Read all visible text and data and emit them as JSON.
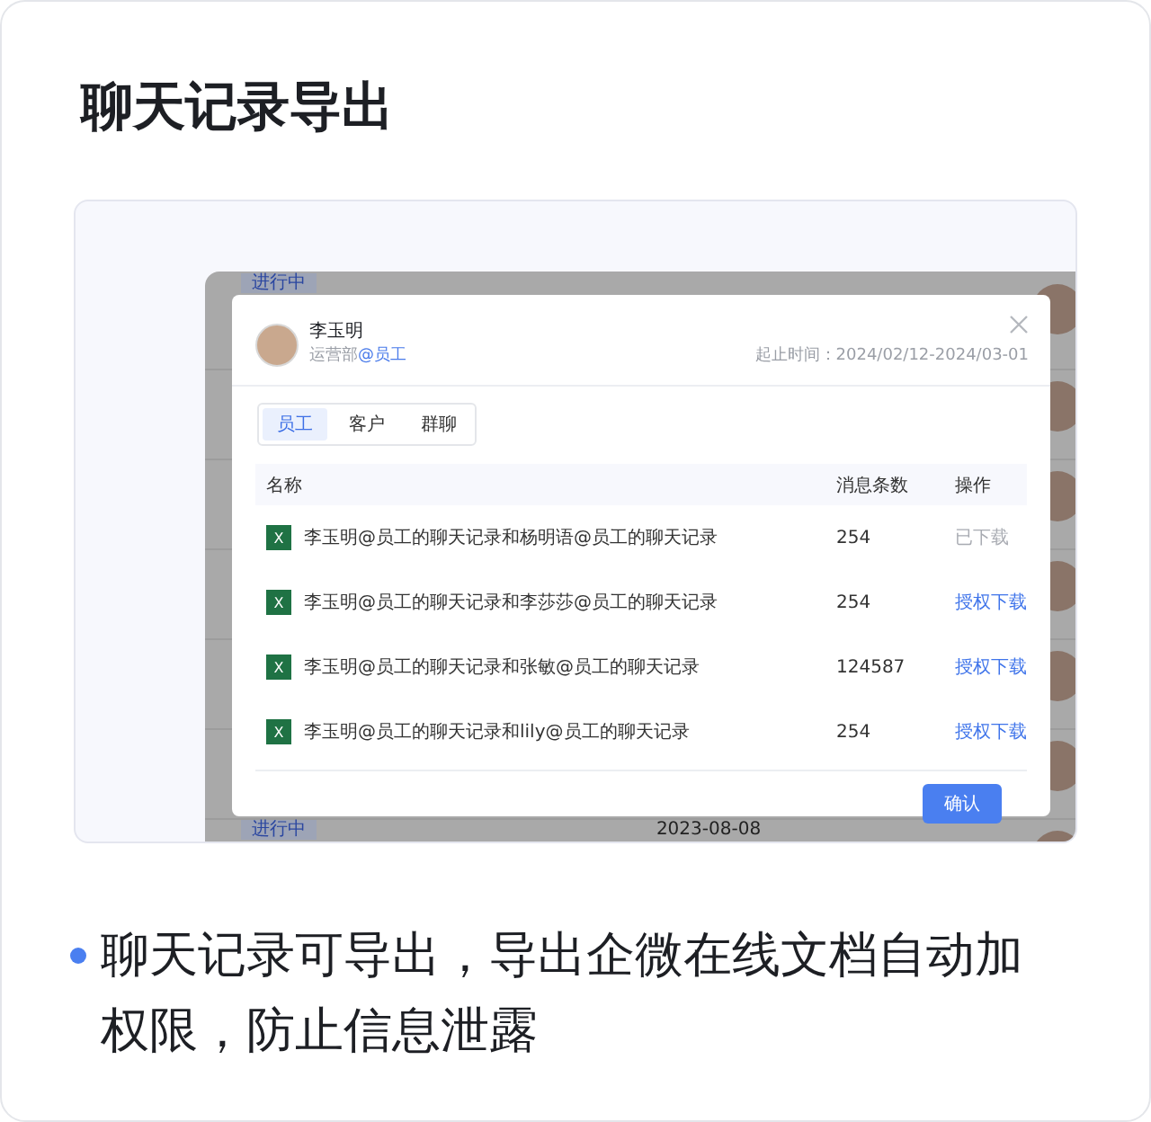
{
  "title": "聊天记录导出",
  "preview": {
    "background_rows": [
      {
        "status": "进行中",
        "date": ""
      },
      {
        "status": "",
        "date": ""
      },
      {
        "status": "",
        "date": ""
      },
      {
        "status": "",
        "date": ""
      },
      {
        "status": "",
        "date": ""
      },
      {
        "status": "",
        "date": ""
      },
      {
        "status": "进行中",
        "date": "2023-08-08"
      }
    ],
    "dialog": {
      "name": "李玉明",
      "department": "运营部",
      "role": "@员工",
      "date_range": "起止时间：2024/02/12-2024/03-01",
      "tabs": [
        {
          "label": "员工",
          "selected": true
        },
        {
          "label": "客户",
          "selected": false
        },
        {
          "label": "群聊",
          "selected": false
        }
      ],
      "columns": [
        "名称",
        "消息条数",
        "操作"
      ],
      "rows": [
        {
          "file_icon": "X",
          "name": "李玉明@员工的聊天记录和杨明语@员工的聊天记录",
          "count": "254",
          "action": "已下载",
          "downloaded": true
        },
        {
          "file_icon": "X",
          "name": "李玉明@员工的聊天记录和李莎莎@员工的聊天记录",
          "count": "254",
          "action": "授权下载",
          "downloaded": false
        },
        {
          "file_icon": "X",
          "name": "李玉明@员工的聊天记录和张敏@员工的聊天记录",
          "count": "124587",
          "action": "授权下载",
          "downloaded": false
        },
        {
          "file_icon": "X",
          "name": "李玉明@员工的聊天记录和lily@员工的聊天记录",
          "count": "254",
          "action": "授权下载",
          "downloaded": false
        }
      ],
      "confirm": "确认"
    }
  },
  "bullets": [
    "聊天记录可导出，导出企微在线文档自动加权限，防止信息泄露"
  ]
}
